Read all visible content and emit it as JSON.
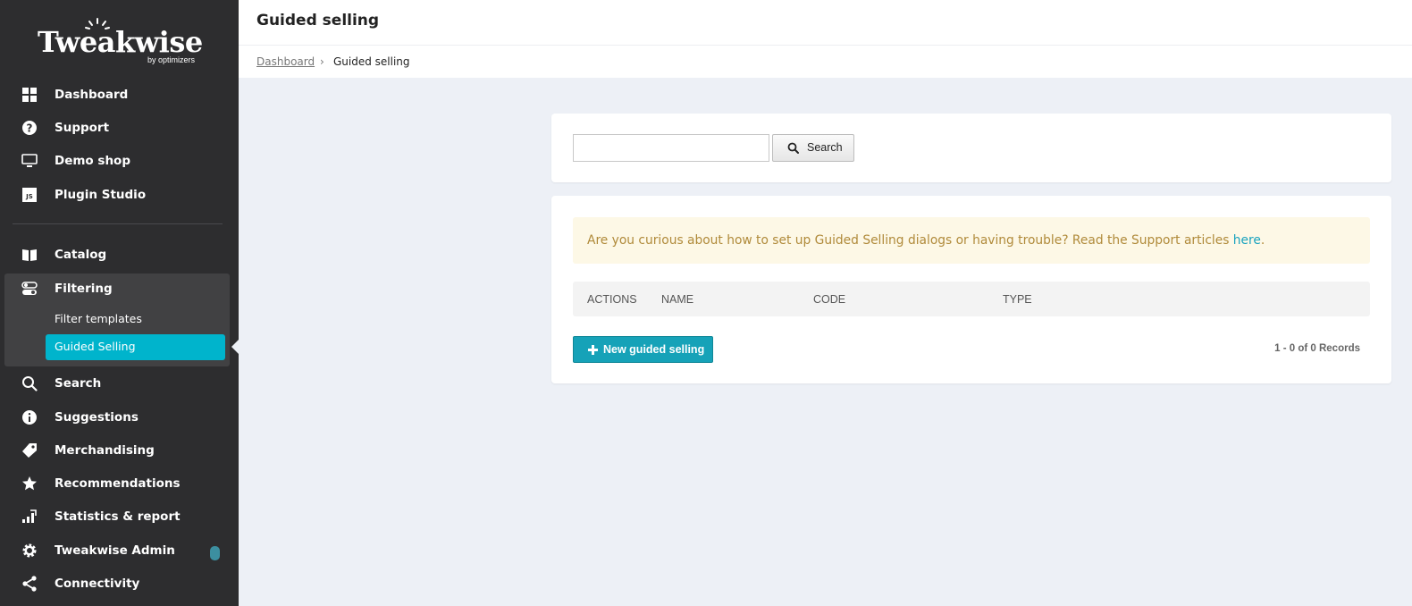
{
  "brand": {
    "name": "Tweakwise",
    "tagline": "by optimizers"
  },
  "sidebar": {
    "top_items": [
      {
        "label": "Dashboard",
        "icon": "grid-icon"
      },
      {
        "label": "Support",
        "icon": "question-circle-icon"
      },
      {
        "label": "Demo shop",
        "icon": "monitor-icon"
      },
      {
        "label": "Plugin Studio",
        "icon": "js-icon"
      }
    ],
    "main_items": [
      {
        "label": "Catalog",
        "icon": "book-icon"
      },
      {
        "label": "Filtering",
        "icon": "toggle-icon"
      },
      {
        "label": "Search",
        "icon": "search-icon"
      },
      {
        "label": "Suggestions",
        "icon": "info-circle-icon"
      },
      {
        "label": "Merchandising",
        "icon": "tag-icon"
      },
      {
        "label": "Recommendations",
        "icon": "star-icon"
      },
      {
        "label": "Statistics & report",
        "icon": "bar-chart-icon"
      },
      {
        "label": "Tweakwise Admin",
        "icon": "gear-icon"
      },
      {
        "label": "Connectivity",
        "icon": "share-icon"
      }
    ],
    "filtering_sub": [
      {
        "label": "Filter templates",
        "active": false
      },
      {
        "label": "Guided Selling",
        "active": true
      }
    ],
    "accent_color": "#00b4cc"
  },
  "header": {
    "title": "Guided selling"
  },
  "breadcrumb": {
    "home": "Dashboard",
    "separator": "›",
    "current": "Guided selling"
  },
  "search": {
    "value": "",
    "button_label": "Search"
  },
  "notice": {
    "text": "Are you curious about how to set up Guided Selling dialogs or having trouble? Read the Support articles ",
    "link_text": "here",
    "suffix": "."
  },
  "table": {
    "columns": [
      "ACTIONS",
      "NAME",
      "CODE",
      "TYPE"
    ],
    "rows": []
  },
  "actions": {
    "new_label": "New guided selling"
  },
  "pagination": {
    "summary": "1 - 0 of 0 Records"
  }
}
